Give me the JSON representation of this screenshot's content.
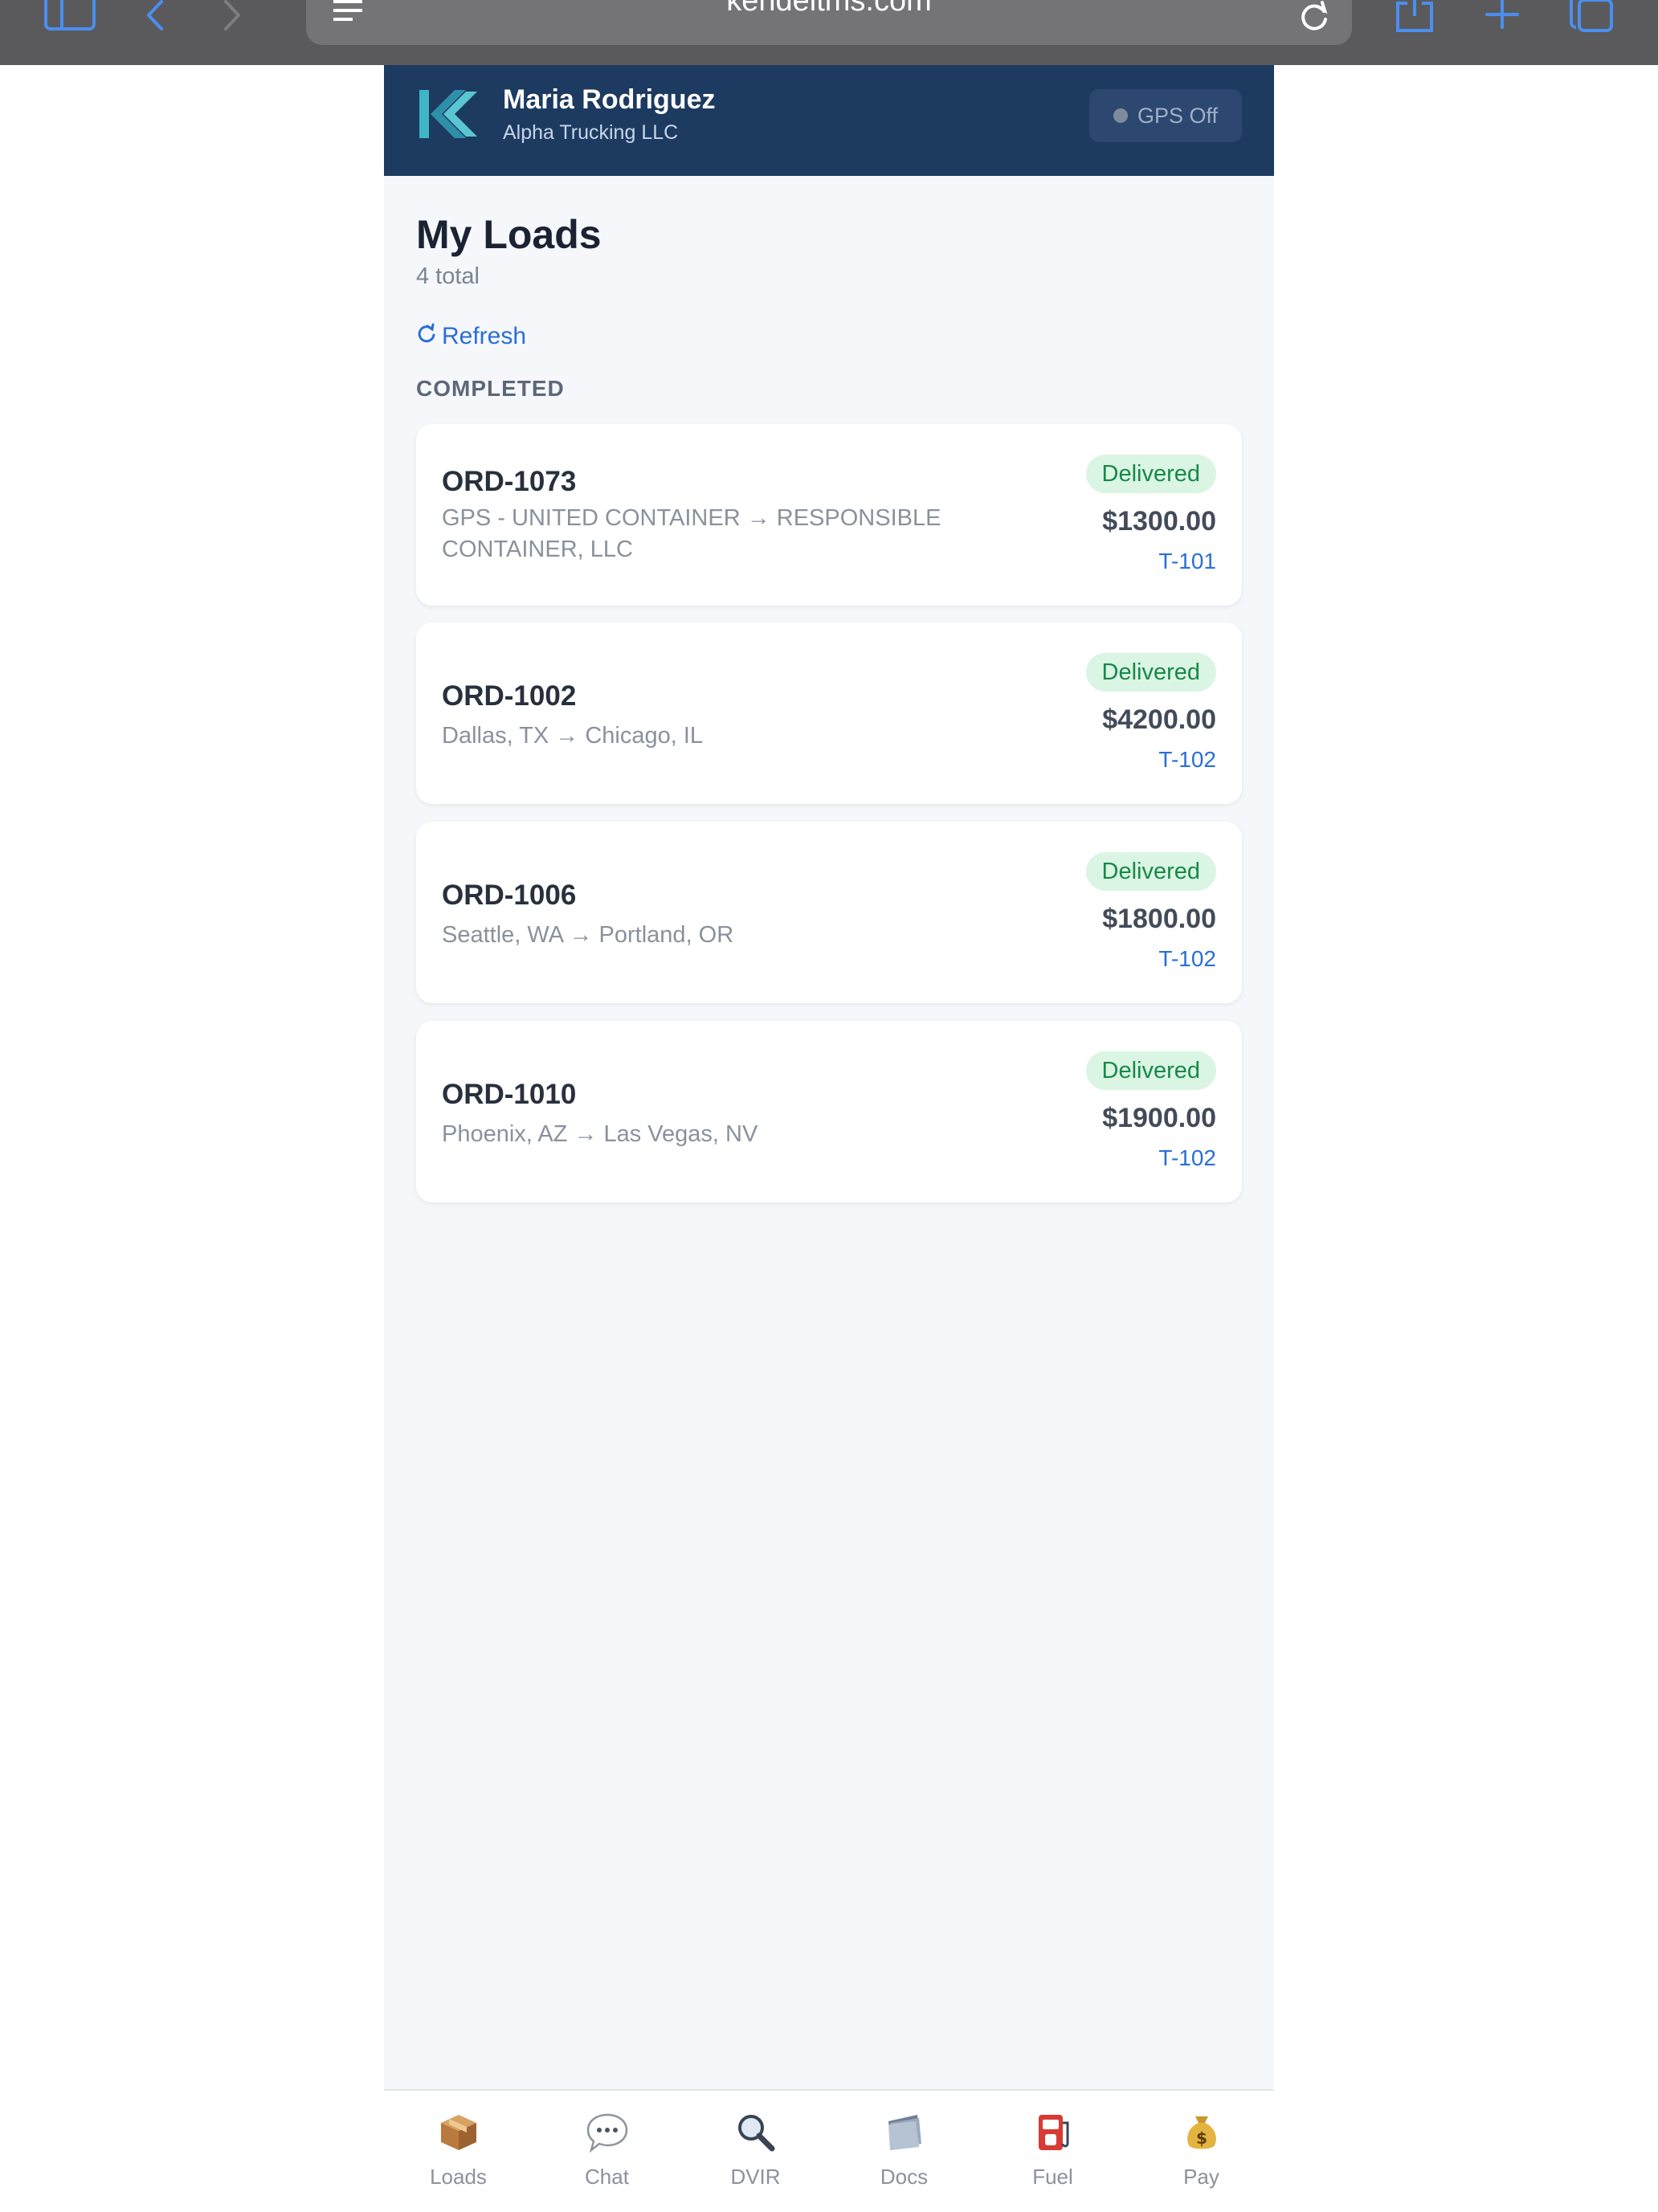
{
  "browser": {
    "url": "kendeltms.com",
    "icons": [
      "sidebar-icon",
      "back-icon",
      "forward-icon",
      "reader-icon",
      "reload-icon",
      "share-icon",
      "new-tab-icon",
      "tabs-icon"
    ]
  },
  "header": {
    "driver_name": "Maria Rodriguez",
    "company": "Alpha Trucking LLC",
    "gps_status": "GPS Off"
  },
  "page": {
    "title": "My Loads",
    "total": "4 total",
    "refresh_label": "Refresh",
    "section_label": "COMPLETED"
  },
  "loads": [
    {
      "order": "ORD-1073",
      "route": "GPS - UNITED CONTAINER → RESPONSIBLE CONTAINER, LLC",
      "status": "Delivered",
      "amount": "$1300.00",
      "truck": "T-101"
    },
    {
      "order": "ORD-1002",
      "route": "Dallas, TX → Chicago, IL",
      "status": "Delivered",
      "amount": "$4200.00",
      "truck": "T-102"
    },
    {
      "order": "ORD-1006",
      "route": "Seattle, WA → Portland, OR",
      "status": "Delivered",
      "amount": "$1800.00",
      "truck": "T-102"
    },
    {
      "order": "ORD-1010",
      "route": "Phoenix, AZ → Las Vegas, NV",
      "status": "Delivered",
      "amount": "$1900.00",
      "truck": "T-102"
    }
  ],
  "tabs": [
    {
      "label": "Loads",
      "icon": "package-icon"
    },
    {
      "label": "Chat",
      "icon": "chat-bubble-icon"
    },
    {
      "label": "DVIR",
      "icon": "magnifier-icon"
    },
    {
      "label": "Docs",
      "icon": "folder-icon"
    },
    {
      "label": "Fuel",
      "icon": "fuel-pump-icon"
    },
    {
      "label": "Pay",
      "icon": "money-bag-icon"
    }
  ],
  "colors": {
    "header_bg": "#1d3a61",
    "link": "#2a6fd6",
    "badge_bg": "#daf5e3",
    "badge_text": "#17884a",
    "browser_bar": "#5a5a5c"
  }
}
